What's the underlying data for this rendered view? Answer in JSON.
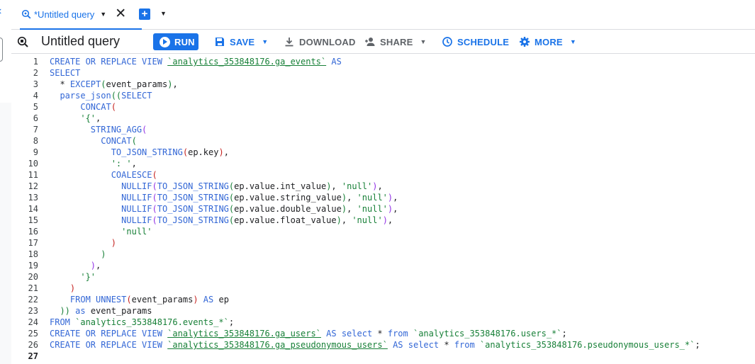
{
  "tab": {
    "title": "*Untitled query"
  },
  "toolbar": {
    "query_title": "Untitled query",
    "run": "RUN",
    "save": "SAVE",
    "download": "DOWNLOAD",
    "share": "SHARE",
    "schedule": "SCHEDULE",
    "more": "MORE"
  },
  "colors": {
    "accent": "#1a73e8",
    "keyword": "#3367d6",
    "string": "#188038"
  },
  "icons": [
    "query-tab-icon",
    "close-icon",
    "add-tab-icon",
    "editor-query-icon",
    "play-icon",
    "save-icon",
    "download-icon",
    "share-person-icon",
    "schedule-clock-icon",
    "gear-icon",
    "caret-down-icon"
  ],
  "editor": {
    "active_line": 27,
    "lines": [
      {
        "n": "1",
        "t": [
          [
            "kw",
            "CREATE OR REPLACE VIEW "
          ],
          [
            "tick",
            "`analytics_353848176.ga_events`"
          ],
          [
            "kw",
            " AS"
          ]
        ]
      },
      {
        "n": "2",
        "t": [
          [
            "kw",
            "SELECT"
          ]
        ]
      },
      {
        "n": "3",
        "t": [
          [
            "id",
            "  * "
          ],
          [
            "kw",
            "EXCEPT"
          ],
          [
            "paren-g",
            "("
          ],
          [
            "id",
            "event_params"
          ],
          [
            "paren-g",
            ")"
          ],
          [
            "id",
            ","
          ]
        ]
      },
      {
        "n": "4",
        "t": [
          [
            "id",
            "  "
          ],
          [
            "fn",
            "parse_json"
          ],
          [
            "paren-g",
            "(("
          ],
          [
            "kw",
            "SELECT"
          ]
        ]
      },
      {
        "n": "5",
        "t": [
          [
            "id",
            "      "
          ],
          [
            "fn",
            "CONCAT"
          ],
          [
            "paren-r",
            "("
          ]
        ]
      },
      {
        "n": "6",
        "t": [
          [
            "id",
            "      "
          ],
          [
            "str",
            "'{'"
          ],
          [
            "id",
            ","
          ]
        ]
      },
      {
        "n": "7",
        "t": [
          [
            "id",
            "        "
          ],
          [
            "fn",
            "STRING_AGG"
          ],
          [
            "paren-p",
            "("
          ]
        ]
      },
      {
        "n": "8",
        "t": [
          [
            "id",
            "          "
          ],
          [
            "fn",
            "CONCAT"
          ],
          [
            "paren-g",
            "("
          ]
        ]
      },
      {
        "n": "9",
        "t": [
          [
            "id",
            "            "
          ],
          [
            "fn",
            "TO_JSON_STRING"
          ],
          [
            "paren-r",
            "("
          ],
          [
            "id",
            "ep.key"
          ],
          [
            "paren-r",
            ")"
          ],
          [
            "id",
            ","
          ]
        ]
      },
      {
        "n": "10",
        "t": [
          [
            "id",
            "            "
          ],
          [
            "str",
            "': '"
          ],
          [
            "id",
            ","
          ]
        ]
      },
      {
        "n": "11",
        "t": [
          [
            "id",
            "            "
          ],
          [
            "fn",
            "COALESCE"
          ],
          [
            "paren-r",
            "("
          ]
        ]
      },
      {
        "n": "12",
        "t": [
          [
            "id",
            "              "
          ],
          [
            "fn",
            "NULLIF"
          ],
          [
            "paren-p",
            "("
          ],
          [
            "fn",
            "TO_JSON_STRING"
          ],
          [
            "paren-g",
            "("
          ],
          [
            "id",
            "ep.value.int_value"
          ],
          [
            "paren-g",
            ")"
          ],
          [
            "id",
            ", "
          ],
          [
            "str",
            "'null'"
          ],
          [
            "paren-p",
            ")"
          ],
          [
            "id",
            ","
          ]
        ]
      },
      {
        "n": "13",
        "t": [
          [
            "id",
            "              "
          ],
          [
            "fn",
            "NULLIF"
          ],
          [
            "paren-p",
            "("
          ],
          [
            "fn",
            "TO_JSON_STRING"
          ],
          [
            "paren-g",
            "("
          ],
          [
            "id",
            "ep.value.string_value"
          ],
          [
            "paren-g",
            ")"
          ],
          [
            "id",
            ", "
          ],
          [
            "str",
            "'null'"
          ],
          [
            "paren-p",
            ")"
          ],
          [
            "id",
            ","
          ]
        ]
      },
      {
        "n": "14",
        "t": [
          [
            "id",
            "              "
          ],
          [
            "fn",
            "NULLIF"
          ],
          [
            "paren-p",
            "("
          ],
          [
            "fn",
            "TO_JSON_STRING"
          ],
          [
            "paren-g",
            "("
          ],
          [
            "id",
            "ep.value.double_value"
          ],
          [
            "paren-g",
            ")"
          ],
          [
            "id",
            ", "
          ],
          [
            "str",
            "'null'"
          ],
          [
            "paren-p",
            ")"
          ],
          [
            "id",
            ","
          ]
        ]
      },
      {
        "n": "15",
        "t": [
          [
            "id",
            "              "
          ],
          [
            "fn",
            "NULLIF"
          ],
          [
            "paren-p",
            "("
          ],
          [
            "fn",
            "TO_JSON_STRING"
          ],
          [
            "paren-g",
            "("
          ],
          [
            "id",
            "ep.value.float_value"
          ],
          [
            "paren-g",
            ")"
          ],
          [
            "id",
            ", "
          ],
          [
            "str",
            "'null'"
          ],
          [
            "paren-p",
            ")"
          ],
          [
            "id",
            ","
          ]
        ]
      },
      {
        "n": "16",
        "t": [
          [
            "id",
            "              "
          ],
          [
            "str",
            "'null'"
          ]
        ]
      },
      {
        "n": "17",
        "t": [
          [
            "id",
            "            "
          ],
          [
            "paren-r",
            ")"
          ]
        ]
      },
      {
        "n": "18",
        "t": [
          [
            "id",
            "          "
          ],
          [
            "paren-g",
            ")"
          ]
        ]
      },
      {
        "n": "19",
        "t": [
          [
            "id",
            "        "
          ],
          [
            "paren-p",
            ")"
          ],
          [
            "id",
            ","
          ]
        ]
      },
      {
        "n": "20",
        "t": [
          [
            "id",
            "      "
          ],
          [
            "str",
            "'}'"
          ]
        ]
      },
      {
        "n": "21",
        "t": [
          [
            "id",
            "    "
          ],
          [
            "paren-r",
            ")"
          ]
        ]
      },
      {
        "n": "22",
        "t": [
          [
            "id",
            "    "
          ],
          [
            "kw",
            "FROM "
          ],
          [
            "fn",
            "UNNEST"
          ],
          [
            "paren-r",
            "("
          ],
          [
            "id",
            "event_params"
          ],
          [
            "paren-r",
            ")"
          ],
          [
            "kw",
            " AS "
          ],
          [
            "id",
            "ep"
          ]
        ]
      },
      {
        "n": "23",
        "t": [
          [
            "id",
            "  "
          ],
          [
            "paren-g",
            "))"
          ],
          [
            "kw",
            " as "
          ],
          [
            "id",
            "event_params"
          ]
        ]
      },
      {
        "n": "24",
        "t": [
          [
            "kw",
            "FROM "
          ],
          [
            "str",
            "`analytics_353848176.events_*`"
          ],
          [
            "id",
            ";"
          ]
        ]
      },
      {
        "n": "25",
        "t": [
          [
            "kw",
            "CREATE OR REPLACE VIEW "
          ],
          [
            "tick",
            "`analytics_353848176.ga_users`"
          ],
          [
            "kw",
            " AS select "
          ],
          [
            "id",
            "* "
          ],
          [
            "kw",
            "from "
          ],
          [
            "str",
            "`analytics_353848176.users_*`"
          ],
          [
            "id",
            ";"
          ]
        ]
      },
      {
        "n": "26",
        "t": [
          [
            "kw",
            "CREATE OR REPLACE VIEW "
          ],
          [
            "tick",
            "`analytics_353848176.ga_pseudonymous_users`"
          ],
          [
            "kw",
            " AS select "
          ],
          [
            "id",
            "* "
          ],
          [
            "kw",
            "from "
          ],
          [
            "str",
            "`analytics_353848176.pseudonymous_users_*`"
          ],
          [
            "id",
            ";"
          ]
        ]
      },
      {
        "n": "27",
        "t": []
      }
    ]
  }
}
